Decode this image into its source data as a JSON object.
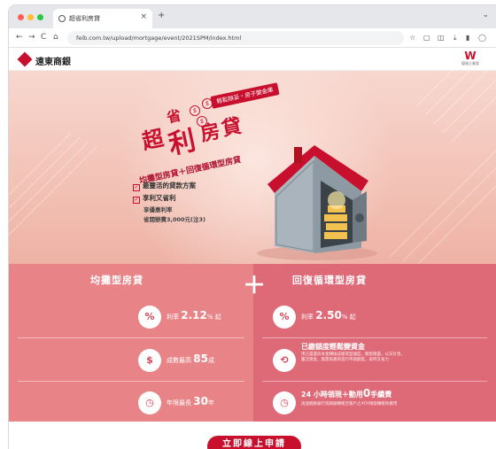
{
  "browser": {
    "tab_title": "超省利房貸",
    "tab_close": "×",
    "new_tab": "+",
    "tab_menu": "⌄",
    "nav_back": "←",
    "nav_forward": "→",
    "nav_reload": "C",
    "nav_home": "⌂",
    "url": "feib.com.tw/upload/mortgage/event/2021SPM/index.html",
    "toolbar_icons": [
      "star-icon",
      "extension-icon",
      "puzzle-icon",
      "download-icon",
      "sidebar-icon",
      "profile-icon"
    ]
  },
  "site": {
    "bank_name": "遠東商銀",
    "award_mark": "W",
    "award_caption": "優質企業獎"
  },
  "hero": {
    "ribbon": "輕鬆辦妥・房子變金庫",
    "coin_symbol": "$",
    "title_chars": [
      "超",
      "省",
      "利",
      "房",
      "貸"
    ],
    "subtitle": "均攤型房貸＋回復循環型房貸",
    "bullet1": "最靈活的貸款方案",
    "bullet2": "享利又省利",
    "note1": "享優惠利率",
    "note2": "省開辦費3,000元(注3)"
  },
  "features": {
    "left_title": "均攤型房貸",
    "right_title": "回復循環型房貸",
    "plus": "＋",
    "left_items": [
      {
        "icon": "%",
        "prefix": "利率",
        "value": "2.12",
        "suffix": "% 起"
      },
      {
        "icon": "$",
        "prefix": "成數最高",
        "value": "85",
        "suffix": "成"
      },
      {
        "icon": "◷",
        "prefix": "年限最長",
        "value": "30",
        "suffix": "年"
      }
    ],
    "right_items": [
      {
        "icon": "%",
        "prefix": "利率",
        "value": "2.50",
        "suffix": "% 起"
      },
      {
        "icon": "⟲",
        "title": "已繳額度輕鬆變資金",
        "detail": "用已還還房本金轉換成循環型額度，隨借隨還，以日計息，靈活資金，無需再重新進行申請額度，省時又省力"
      },
      {
        "icon": "◷",
        "title_prefix": "24 小時領現＋動用",
        "title_value": "0",
        "title_suffix": "手續費",
        "detail": "透過網路銀行或網銀轉帳至帳戶之ATM領取轉帳免費用"
      }
    ]
  },
  "cta": {
    "label": "立即線上申請"
  },
  "colors": {
    "brand": "#c8102e",
    "hero_bg": "#f3c3b7",
    "left_panel": "#e88487",
    "right_panel": "#de6a78"
  }
}
